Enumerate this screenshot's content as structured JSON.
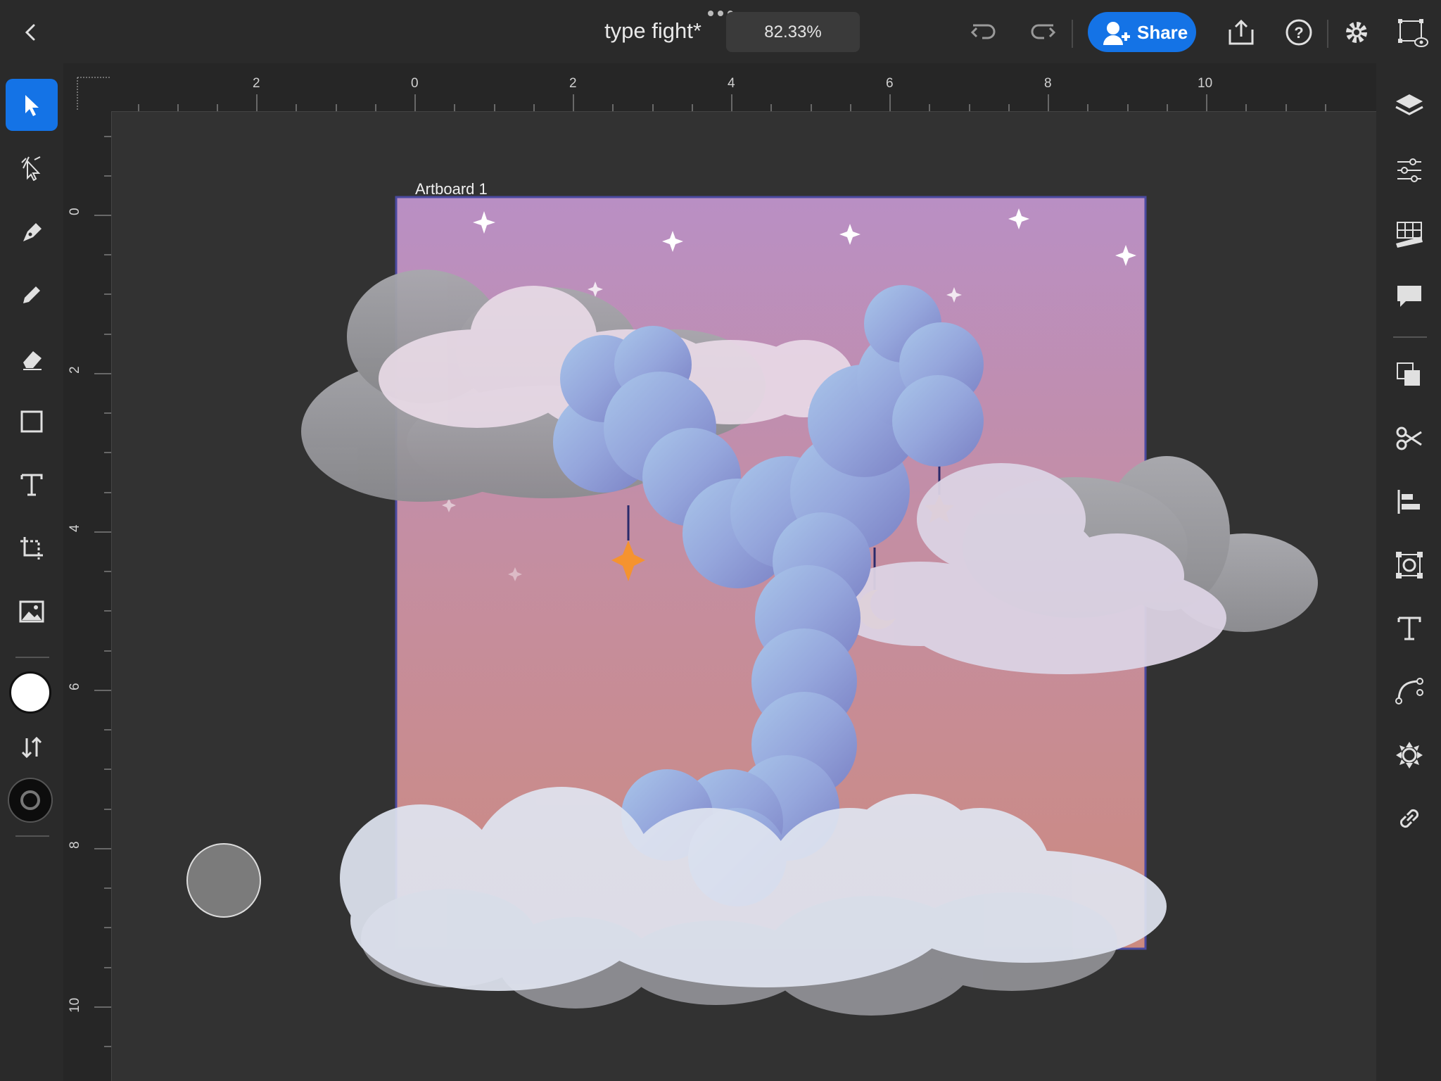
{
  "toolbar": {
    "doc_title": "type fight*",
    "zoom": "82.33%",
    "share_label": "Share",
    "icons": [
      "back-icon",
      "more-dots-icon",
      "undo-icon",
      "redo-icon",
      "share-user-icon",
      "export-icon",
      "help-icon",
      "settings-icon",
      "selection-view-icon"
    ]
  },
  "tools": {
    "items": [
      "select",
      "direct-select",
      "pen",
      "pencil",
      "eraser",
      "rectangle",
      "type",
      "transform",
      "image"
    ],
    "active": "select",
    "fill_color": "#ffffff",
    "stroke_color": "#000000"
  },
  "ruler": {
    "horizontal": [
      "2",
      "0",
      "2",
      "4",
      "6",
      "8",
      "10"
    ],
    "vertical": [
      "0",
      "2",
      "4",
      "6",
      "8",
      "10"
    ]
  },
  "canvas": {
    "artboard_label": "Artboard 1",
    "accent": "#1473e6"
  },
  "right_panel": {
    "icons": [
      "layers-icon",
      "properties-icon",
      "grid-icon",
      "comments-icon",
      "combine-shapes-icon",
      "cut-icon",
      "align-icon",
      "repeat-grid-icon",
      "type-icon",
      "path-icon",
      "assets-icon",
      "link-icon"
    ]
  }
}
